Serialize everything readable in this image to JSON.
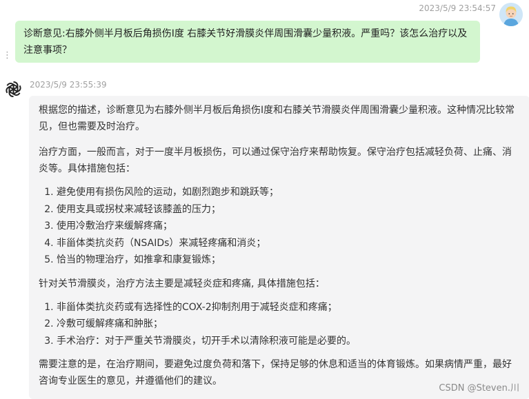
{
  "user_message": {
    "timestamp": "2023/5/9 23:54:57",
    "text": "诊断意见:右膝外侧半月板后角损伤I度  右膝关节好滑膜炎伴周围滑囊少量积液。严重吗？该怎么治疗以及注意事项？"
  },
  "bot_message": {
    "timestamp": "2023/5/9 23:55:39",
    "paragraph1": "根据您的描述，诊断意见为右膝外侧半月板后角损伤I度和右膝关节滑膜炎伴周围滑囊少量积液。这种情况比较常见，但也需要及时治疗。",
    "paragraph2": "治疗方面，一般而言，对于一度半月板损伤，可以通过保守治疗来帮助恢复。保守治疗包括减轻负荷、止痛、消炎等。具体措施包括：",
    "list1": [
      "避免使用有损伤风险的运动，如剧烈跑步和跳跃等；",
      "使用支具或拐杖来减轻该膝盖的压力；",
      "使用冷敷治疗来缓解疼痛；",
      "非甾体类抗炎药（NSAIDs）来减轻疼痛和消炎；",
      "恰当的物理治疗，如推拿和康复锻炼；"
    ],
    "paragraph3": "针对关节滑膜炎，治疗方法主要是减轻炎症和疼痛, 具体措施包括：",
    "list2": [
      "非甾体类抗炎药或有选择性的COX-2抑制剂用于减轻炎症和疼痛；",
      "冷敷可缓解疼痛和肿胀；",
      "手术治疗：对于严重关节滑膜炎，切开手术以清除积液可能是必要的。"
    ],
    "paragraph4": "需要注意的是，在治疗期间，要避免过度负荷和落下，保持足够的休息和适当的体育锻炼。如果病情严重，最好咨询专业医生的意见，并遵循他们的建议。"
  },
  "watermark": "CSDN @Steven.川",
  "colors": {
    "user_bubble": "#d3f6cf",
    "bot_bubble": "#f4f4f5",
    "timestamp": "#a0a0a0"
  },
  "icons": {
    "user_avatar": "user-avatar-icon",
    "bot_logo": "openai-logo-icon",
    "menu": "vertical-dots-icon"
  }
}
